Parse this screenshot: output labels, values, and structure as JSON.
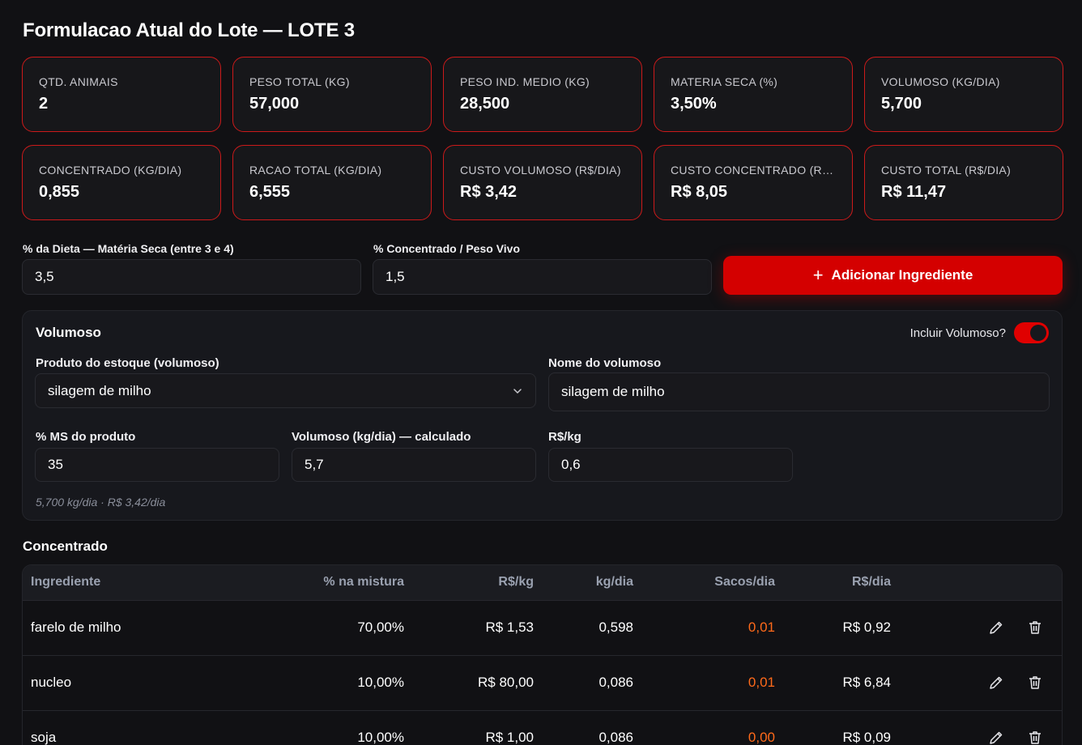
{
  "title": "Formulacao Atual do Lote — LOTE 3",
  "stats_row1": [
    {
      "label": "QTD. ANIMAIS",
      "value": "2"
    },
    {
      "label": "PESO TOTAL (KG)",
      "value": "57,000"
    },
    {
      "label": "PESO IND. MEDIO (KG)",
      "value": "28,500"
    },
    {
      "label": "MATERIA SECA (%)",
      "value": "3,50%"
    },
    {
      "label": "VOLUMOSO (KG/DIA)",
      "value": "5,700"
    }
  ],
  "stats_row2": [
    {
      "label": "CONCENTRADO (KG/DIA)",
      "value": "0,855"
    },
    {
      "label": "RACAO TOTAL (KG/DIA)",
      "value": "6,555"
    },
    {
      "label": "CUSTO VOLUMOSO (R$/DIA)",
      "value": "R$ 3,42"
    },
    {
      "label": "CUSTO CONCENTRADO (R$/...",
      "value": "R$ 8,05"
    },
    {
      "label": "CUSTO TOTAL (R$/DIA)",
      "value": "R$ 11,47"
    }
  ],
  "diet": {
    "ms_label": "% da Dieta — Matéria Seca (entre 3 e 4)",
    "ms_value": "3,5",
    "conc_label": "% Concentrado / Peso Vivo",
    "conc_value": "1,5",
    "add_button": "Adicionar Ingrediente",
    "add_icon": "+"
  },
  "volumoso": {
    "title": "Volumoso",
    "toggle_label": "Incluir Volumoso?",
    "toggle_on": true,
    "product_label": "Produto do estoque (volumoso)",
    "product_value": "silagem de milho",
    "name_label": "Nome do volumoso",
    "name_value": "silagem de milho",
    "ms_label": "% MS do produto",
    "ms_value": "35",
    "kg_label": "Volumoso (kg/dia) — calculado",
    "kg_value": "5,7",
    "price_label": "R$/kg",
    "price_value": "0,6",
    "summary": "5,700 kg/dia · R$ 3,42/dia"
  },
  "concentrado": {
    "title": "Concentrado",
    "headers": [
      "Ingrediente",
      "% na mistura",
      "R$/kg",
      "kg/dia",
      "Sacos/dia",
      "R$/dia"
    ],
    "rows": [
      {
        "ingrediente": "farelo de milho",
        "mistura": "70,00%",
        "rskg": "R$ 1,53",
        "kgdia": "0,598",
        "sacos": "0,01",
        "rsdia": "R$ 0,92"
      },
      {
        "ingrediente": "nucleo",
        "mistura": "10,00%",
        "rskg": "R$ 80,00",
        "kgdia": "0,086",
        "sacos": "0,01",
        "rsdia": "R$ 6,84"
      },
      {
        "ingrediente": "soja",
        "mistura": "10,00%",
        "rskg": "R$ 1,00",
        "kgdia": "0,086",
        "sacos": "0,00",
        "rsdia": "R$ 0,09"
      }
    ]
  },
  "colors": {
    "accent": "#d40000",
    "card_border": "#cc1a1a",
    "warning": "#ff6a1a"
  },
  "icons": {
    "edit": "pencil-icon",
    "delete": "trash-icon",
    "select": "chevron-down-icon"
  }
}
